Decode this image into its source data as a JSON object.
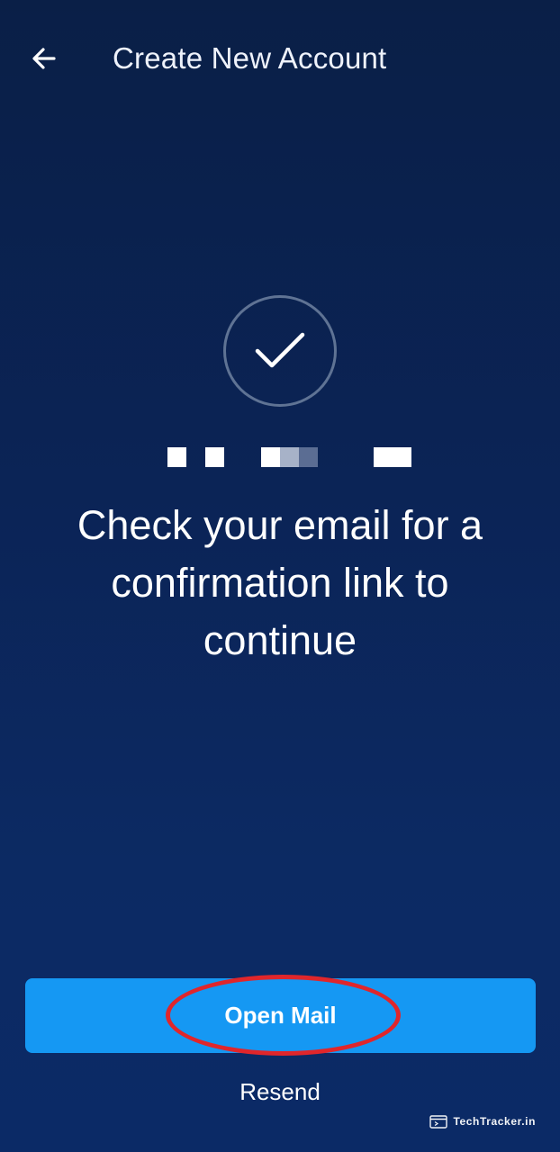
{
  "header": {
    "back_icon": "arrow-left-icon",
    "title": "Create New Account"
  },
  "status": {
    "icon": "checkmark-circle-icon",
    "email_redacted": true,
    "message": "Check your email for a confirmation link to continue"
  },
  "actions": {
    "primary_label": "Open Mail",
    "secondary_label": "Resend"
  },
  "watermark": {
    "text": "TechTracker.in"
  },
  "colors": {
    "background_top": "#0a1f47",
    "background_bottom": "#0b2a66",
    "primary_button": "#1598f3",
    "circle_outline": "#5f7394",
    "annotation_ring": "#e0262b"
  }
}
